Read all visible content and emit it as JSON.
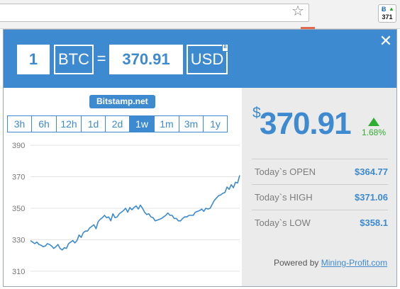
{
  "extension_badge": {
    "currency_symbol": "Ƀ",
    "price": "371"
  },
  "converter": {
    "amount": "1",
    "from_currency": "BTC",
    "equals": "=",
    "converted_amount": "370.91",
    "to_currency": "USD"
  },
  "source": "Bitstamp.net",
  "periods": [
    "3h",
    "6h",
    "12h",
    "1d",
    "2d",
    "1w",
    "1m",
    "3m",
    "1y"
  ],
  "active_period": "1w",
  "chart_data": {
    "type": "line",
    "title": "",
    "xlabel": "",
    "ylabel": "",
    "ylim": [
      305,
      395
    ],
    "yticks": [
      390,
      370,
      350,
      330,
      310
    ],
    "series": [
      {
        "values": [
          329.5,
          328.5,
          327.5,
          328.5,
          327,
          326.5,
          325.5,
          326,
          327.5,
          327,
          326,
          324.5,
          325.5,
          327,
          324.5,
          323.5,
          325,
          324.5,
          327.5,
          328.5,
          329.5,
          328,
          329.5,
          333,
          331.5,
          334.5,
          335.5,
          335.5,
          337.5,
          338.5,
          339.5,
          337,
          341.5,
          343,
          344,
          345.5,
          344,
          344.5,
          342,
          346.5,
          344,
          344.5,
          346.5,
          347.5,
          348.5,
          350,
          347.5,
          350.5,
          349,
          350.5,
          351.5,
          349.5,
          352,
          350,
          347.5,
          346,
          346.5,
          344.5,
          344,
          342,
          342.5,
          343,
          343.5,
          344.5,
          345.5,
          347,
          345.5,
          345.5,
          343.5,
          343.5,
          342,
          342,
          343.5,
          344.5,
          344.5,
          345.5,
          345.5,
          345.5,
          347.5,
          348,
          348.5,
          349.5,
          348,
          350,
          349.5,
          350,
          352.5,
          355,
          356.5,
          358,
          358.5,
          359.5,
          360,
          363.5,
          362,
          365,
          363,
          366.5,
          366,
          370.91
        ]
      }
    ],
    "colors": {
      "line": "#3d8ad0",
      "grid": "#e3e3e3",
      "tick_label": "#777777"
    }
  },
  "ticker": {
    "currency_symbol": "$",
    "price": "370.91",
    "change": "1.68%",
    "stats": [
      {
        "label": "Today`s OPEN",
        "value": "$364.77"
      },
      {
        "label": "Today`s HIGH",
        "value": "$371.06"
      },
      {
        "label": "Today`s LOW",
        "value": "$358.1"
      }
    ],
    "powered_prefix": "Powered by",
    "powered_link": "Mining-Profit.com"
  },
  "colors": {
    "accent": "#3d8ad0",
    "up": "#2fae2f",
    "panel": "#ebebeb"
  },
  "icons": {
    "close": "close-icon",
    "star": "star-icon",
    "up": "up-arrow-icon"
  }
}
